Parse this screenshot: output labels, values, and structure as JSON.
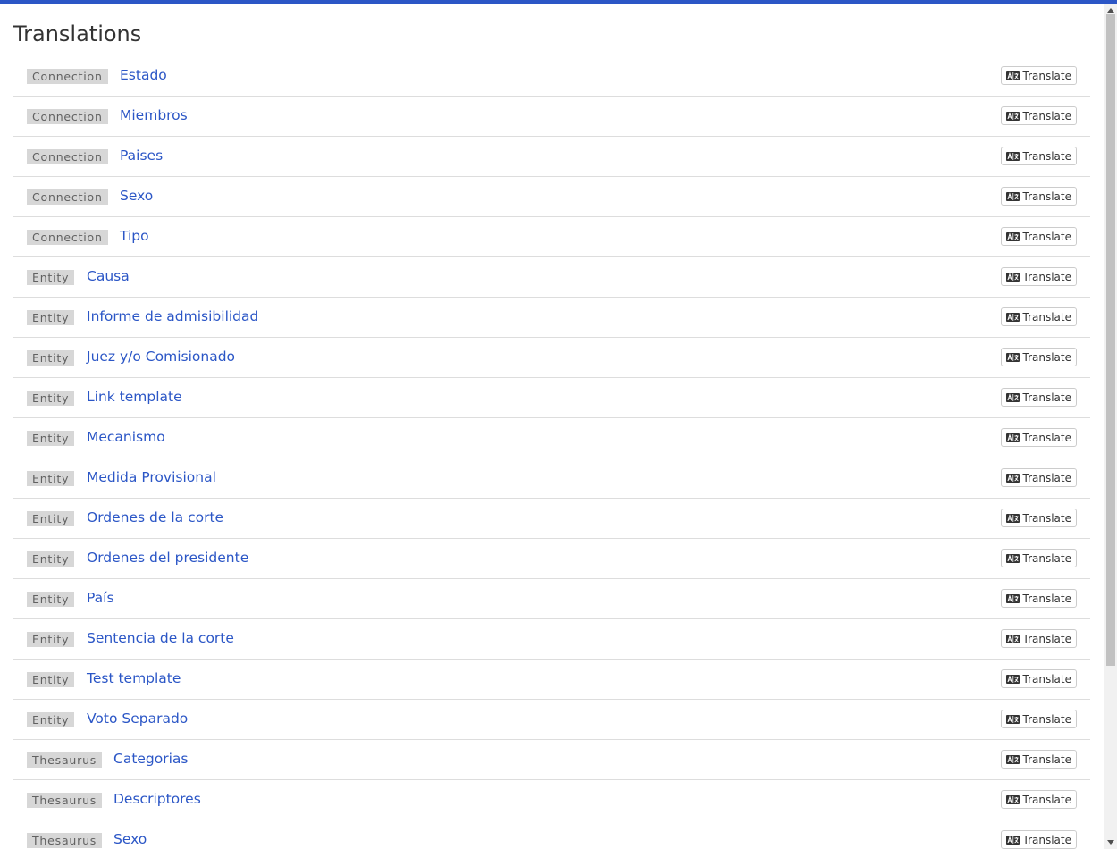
{
  "page": {
    "title": "Translations",
    "translate_label": "Translate",
    "accent_color": "#2b56c6"
  },
  "rows": [
    {
      "type": "Connection",
      "name": "Estado"
    },
    {
      "type": "Connection",
      "name": "Miembros"
    },
    {
      "type": "Connection",
      "name": "Paises"
    },
    {
      "type": "Connection",
      "name": "Sexo"
    },
    {
      "type": "Connection",
      "name": "Tipo"
    },
    {
      "type": "Entity",
      "name": "Causa"
    },
    {
      "type": "Entity",
      "name": "Informe de admisibilidad"
    },
    {
      "type": "Entity",
      "name": "Juez y/o Comisionado"
    },
    {
      "type": "Entity",
      "name": "Link template"
    },
    {
      "type": "Entity",
      "name": "Mecanismo"
    },
    {
      "type": "Entity",
      "name": "Medida Provisional"
    },
    {
      "type": "Entity",
      "name": "Ordenes de la corte"
    },
    {
      "type": "Entity",
      "name": "Ordenes del presidente"
    },
    {
      "type": "Entity",
      "name": "País"
    },
    {
      "type": "Entity",
      "name": "Sentencia de la corte"
    },
    {
      "type": "Entity",
      "name": "Test template"
    },
    {
      "type": "Entity",
      "name": "Voto Separado"
    },
    {
      "type": "Thesaurus",
      "name": "Categorias"
    },
    {
      "type": "Thesaurus",
      "name": "Descriptores"
    },
    {
      "type": "Thesaurus",
      "name": "Sexo"
    }
  ],
  "icons": {
    "translate": "language-icon"
  }
}
